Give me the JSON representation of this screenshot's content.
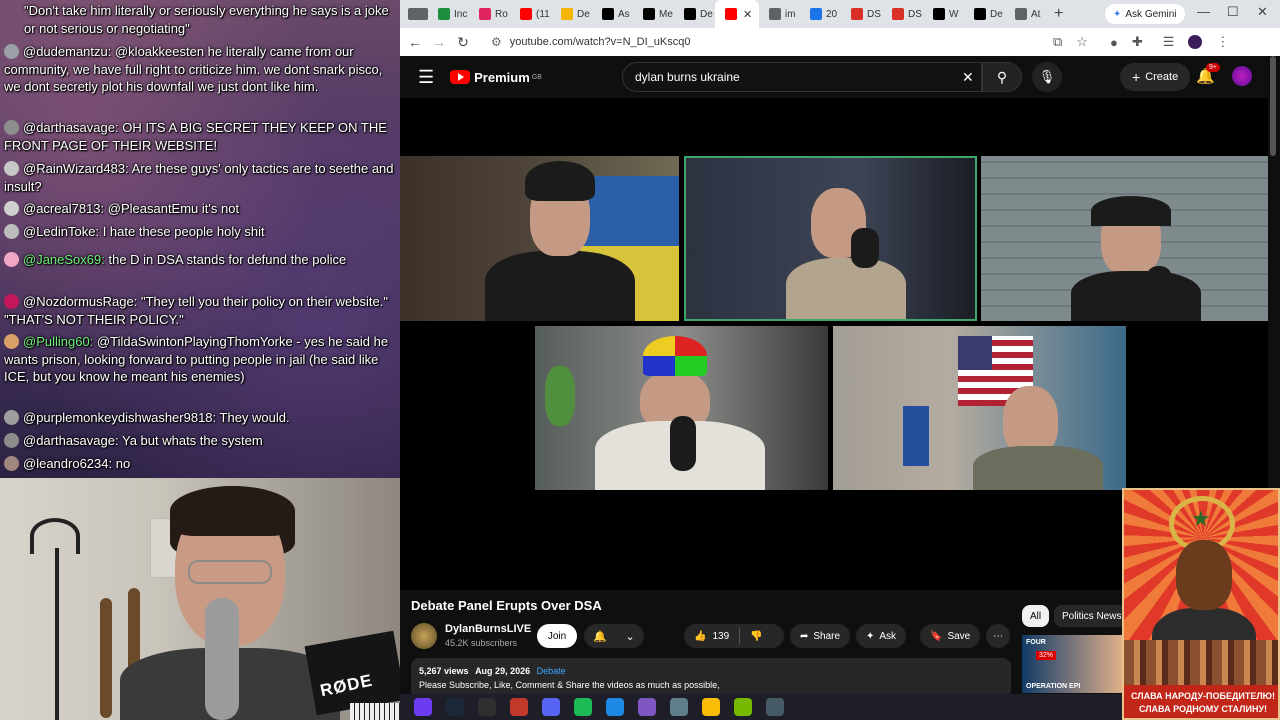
{
  "chat": {
    "messages": [
      {
        "user": "",
        "text": "\"Don't take him literally or seriously everything he says is a joke or not serious or negotiating\"",
        "color": "#ffffff",
        "avatar_color": ""
      },
      {
        "user": "@dudemantzu:",
        "text": "@kloakkeesten he literally came from our community, we have full right to criticize him. we dont snark pisco, we dont secretly plot his downfall we just dont like him.",
        "color": "#ffffff",
        "avatar_color": "#9aa0a6"
      },
      {
        "user": "@darthasavage:",
        "text": "OH ITS A BIG SECRET THEY KEEP ON THE FRONT PAGE OF THEIR WEBSITE!",
        "color": "#ffffff",
        "avatar_color": "#8d8d8d"
      },
      {
        "user": "@RainWizard483:",
        "text": "Are these guys' only tactics are to seethe and insult?",
        "color": "#ffffff",
        "avatar_color": "#c7c7c7"
      },
      {
        "user": "@acreal7813:",
        "text": "@PleasantEmu it's not",
        "color": "#ffffff",
        "avatar_color": "#d0d0d0"
      },
      {
        "user": "@LedinToke:",
        "text": "I hate these people holy shit",
        "color": "#ffffff",
        "avatar_color": "#bdbdbd"
      },
      {
        "user": "@JaneSox69:",
        "text": "the D in DSA stands for defund the police",
        "color": "#6ef07a",
        "avatar_color": "#f1a7c3"
      },
      {
        "user": "@NozdormusRage:",
        "text": "\"They tell you their policy on their website.\" \"THAT'S NOT THEIR POLICY.\"",
        "color": "#ffffff",
        "avatar_color": "#c2185b"
      },
      {
        "user": "@Pulling60:",
        "text": "@TildaSwintonPlayingThomYorke - yes he said he wants prison, looking forward to putting people in jail (he said like ICE, but you know he meant his enemies)",
        "color": "#6ef07a",
        "avatar_color": "#d9a066"
      },
      {
        "user": "@purplemonkeydishwasher9818:",
        "text": "They would.",
        "color": "#ffffff",
        "avatar_color": "#9e9e9e"
      },
      {
        "user": "@darthasavage:",
        "text": "Ya but whats the system",
        "color": "#ffffff",
        "avatar_color": "#8d8d8d"
      },
      {
        "user": "@leandro6234:",
        "text": "no",
        "color": "#ffffff",
        "avatar_color": "#a1887f"
      }
    ]
  },
  "webcam": {
    "mic_brand": "RØDE"
  },
  "browser": {
    "tabs": [
      {
        "label": "Inc",
        "icon_color": "#1e8e3e"
      },
      {
        "label": "Ro",
        "icon_color": "#e0245e"
      },
      {
        "label": "(11",
        "icon_color": "#ff0000"
      },
      {
        "label": "De",
        "icon_color": "#f4b400"
      },
      {
        "label": "As",
        "icon_color": "#000000"
      },
      {
        "label": "Me",
        "icon_color": "#000000"
      },
      {
        "label": "De",
        "icon_color": "#000000"
      },
      {
        "label": "",
        "icon_color": "#ff0000",
        "active": true
      },
      {
        "label": "im",
        "icon_color": "#5f6368"
      },
      {
        "label": "20",
        "icon_color": "#1a73e8"
      },
      {
        "label": "DS",
        "icon_color": "#d93025"
      },
      {
        "label": "DS",
        "icon_color": "#d93025"
      },
      {
        "label": "W",
        "icon_color": "#000000"
      },
      {
        "label": "De",
        "icon_color": "#000000"
      },
      {
        "label": "At",
        "icon_color": "#5f6368"
      }
    ],
    "ask_gemini": "Ask Gemini",
    "url": "youtube.com/watch?v=N_DI_uKscq0"
  },
  "youtube": {
    "logo_text": "Premium",
    "region": "GB",
    "search_value": "dylan burns ukraine",
    "create_label": "Create",
    "notification_count": "9+",
    "video_title": "Debate Panel Erupts Over DSA",
    "channel_name": "DylanBurnsLIVE",
    "subscribers": "45.2K subscribers",
    "join_label": "Join",
    "likes": "139",
    "share_label": "Share",
    "ask_label": "Ask",
    "save_label": "Save",
    "views": "5,267 views",
    "date": "Aug 29, 2026",
    "tag": "Debate",
    "description": "Please Subscribe, Like, Comment & Share the videos as much as possible,",
    "chips": [
      "All",
      "Politics News"
    ],
    "thumb_text_top": "FOUR",
    "thumb_badge": "32%",
    "thumb_text_bottom": "OPERATION EPI"
  },
  "poster": {
    "caption1": "СЛАВА НАРОДУ-ПОБЕДИТЕЛЮ!",
    "caption2": "СЛАВА РОДНОМУ СТАЛИНУ!"
  },
  "taskbar": {
    "apps": [
      {
        "name": "arc-icon",
        "color": "#6b3cf0"
      },
      {
        "name": "steam-icon",
        "color": "#1b2838"
      },
      {
        "name": "obs-icon",
        "color": "#302e31"
      },
      {
        "name": "app-red-icon",
        "color": "#c0392b"
      },
      {
        "name": "discord-icon",
        "color": "#5865f2"
      },
      {
        "name": "spotify-icon",
        "color": "#1db954"
      },
      {
        "name": "blue-app-icon",
        "color": "#1e88e5"
      },
      {
        "name": "purple-app-icon",
        "color": "#7e57c2"
      },
      {
        "name": "settings-app-icon",
        "color": "#607d8b"
      },
      {
        "name": "chrome-icon",
        "color": "#fbbc05"
      },
      {
        "name": "nvidia-icon",
        "color": "#76b900"
      },
      {
        "name": "tool-app-icon",
        "color": "#455a64"
      }
    ]
  }
}
